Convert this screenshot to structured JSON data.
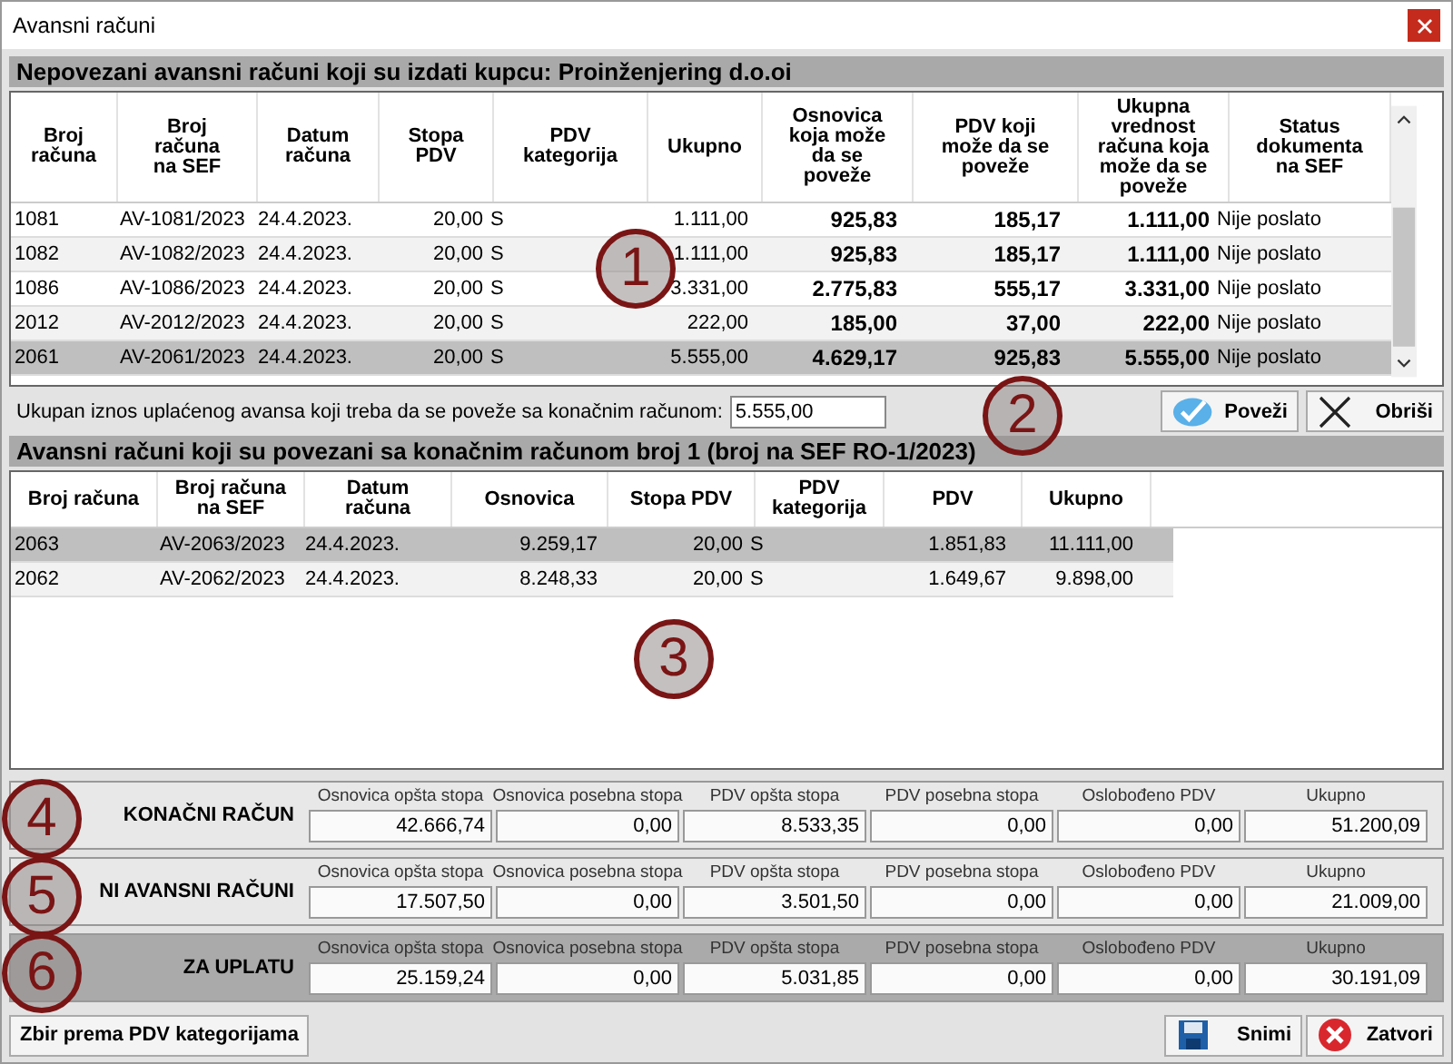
{
  "window": {
    "title": "Avansni računi"
  },
  "unlinked": {
    "title": "Nepovezani avansni računi koji su izdati kupcu: Proinženjering d.o.oi",
    "columns": [
      {
        "label": "Broj\nračuna",
        "bold": false
      },
      {
        "label": "Broj\nračuna\nna SEF",
        "bold": false
      },
      {
        "label": "Datum\nračuna",
        "bold": false
      },
      {
        "label": "Stopa\nPDV",
        "bold": false
      },
      {
        "label": "PDV\nkategorija",
        "bold": false
      },
      {
        "label": "Ukupno",
        "bold": false
      },
      {
        "label": "Osnovica\nkoja može\nda se\npoveže",
        "bold": true
      },
      {
        "label": "PDV koji\nmože da se\npoveže",
        "bold": true
      },
      {
        "label": "Ukupna\nvrednost\nračuna koja\nmože da se\npoveže",
        "bold": true
      },
      {
        "label": "Status\ndokumenta\nna SEF",
        "bold": false
      }
    ],
    "rows": [
      {
        "cells": [
          "1081",
          "AV-1081/2023",
          "24.4.2023.",
          "20,00",
          "S",
          "1.111,00",
          "925,83",
          "185,17",
          "1.111,00",
          "Nije poslato"
        ],
        "selected": false
      },
      {
        "cells": [
          "1082",
          "AV-1082/2023",
          "24.4.2023.",
          "20,00",
          "S",
          "1.111,00",
          "925,83",
          "185,17",
          "1.111,00",
          "Nije poslato"
        ],
        "selected": false
      },
      {
        "cells": [
          "1086",
          "AV-1086/2023",
          "24.4.2023.",
          "20,00",
          "S",
          "3.331,00",
          "2.775,83",
          "555,17",
          "3.331,00",
          "Nije poslato"
        ],
        "selected": false
      },
      {
        "cells": [
          "2012",
          "AV-2012/2023",
          "24.4.2023.",
          "20,00",
          "S",
          "222,00",
          "185,00",
          "37,00",
          "222,00",
          "Nije poslato"
        ],
        "selected": false
      },
      {
        "cells": [
          "2061",
          "AV-2061/2023",
          "24.4.2023.",
          "20,00",
          "S",
          "5.555,00",
          "4.629,17",
          "925,83",
          "5.555,00",
          "Nije poslato"
        ],
        "selected": true
      }
    ]
  },
  "advance": {
    "label": "Ukupan iznos uplaćenog avansa koji treba da se poveže sa konačnim računom:",
    "value": "5.555,00"
  },
  "buttons": [
    {
      "label": "Poveži",
      "kind": "check"
    },
    {
      "label": "Obriši",
      "kind": "delete"
    }
  ],
  "linked": {
    "title": "Avansni računi koji su povezani sa konačnim računom broj 1 (broj na SEF RO-1/2023)",
    "columns": [
      "Broj računa",
      "Broj računa\nna SEF",
      "Datum\nračuna",
      "Osnovica",
      "Stopa PDV",
      "PDV\nkategorija",
      "PDV",
      "Ukupno"
    ],
    "rows": [
      {
        "cells": [
          "2063",
          "AV-2063/2023",
          "24.4.2023.",
          "9.259,17",
          "20,00",
          "S",
          "1.851,83",
          "11.111,00"
        ],
        "selected": true
      },
      {
        "cells": [
          "2062",
          "AV-2062/2023",
          "24.4.2023.",
          "8.248,33",
          "20,00",
          "S",
          "1.649,67",
          "9.898,00"
        ],
        "selected": false
      }
    ]
  },
  "summaries": [
    {
      "title": "KONAČNI RAČUN",
      "highlighted": false,
      "fields": [
        {
          "label": "Osnovica opšta stopa",
          "value": "42.666,74"
        },
        {
          "label": "Osnovica posebna stopa",
          "value": "0,00"
        },
        {
          "label": "PDV opšta stopa",
          "value": "8.533,35"
        },
        {
          "label": "PDV posebna stopa",
          "value": "0,00"
        },
        {
          "label": "Oslobođeno PDV",
          "value": "0,00"
        },
        {
          "label": "Ukupno",
          "value": "51.200,09"
        }
      ]
    },
    {
      "title": "NI AVANSNI RAČUNI",
      "highlighted": false,
      "fields": [
        {
          "label": "Osnovica opšta stopa",
          "value": "17.507,50"
        },
        {
          "label": "Osnovica posebna stopa",
          "value": "0,00"
        },
        {
          "label": "PDV opšta stopa",
          "value": "3.501,50"
        },
        {
          "label": "PDV posebna stopa",
          "value": "0,00"
        },
        {
          "label": "Oslobođeno PDV",
          "value": "0,00"
        },
        {
          "label": "Ukupno",
          "value": "21.009,00"
        }
      ]
    },
    {
      "title": "ZA UPLATU",
      "highlighted": true,
      "fields": [
        {
          "label": "Osnovica opšta stopa",
          "value": "25.159,24"
        },
        {
          "label": "Osnovica posebna stopa",
          "value": "0,00"
        },
        {
          "label": "PDV opšta stopa",
          "value": "5.031,85"
        },
        {
          "label": "PDV posebna stopa",
          "value": "0,00"
        },
        {
          "label": "Oslobođeno PDV",
          "value": "0,00"
        },
        {
          "label": "Ukupno",
          "value": "30.191,09"
        }
      ]
    }
  ],
  "footer": {
    "summary_button": "Zbir prema PDV kategorijama",
    "buttons": [
      {
        "label": "Snimi",
        "kind": "save"
      },
      {
        "label": "Zatvori",
        "kind": "close"
      }
    ]
  },
  "callouts": [
    "1",
    "2",
    "3",
    "4",
    "5",
    "6"
  ]
}
